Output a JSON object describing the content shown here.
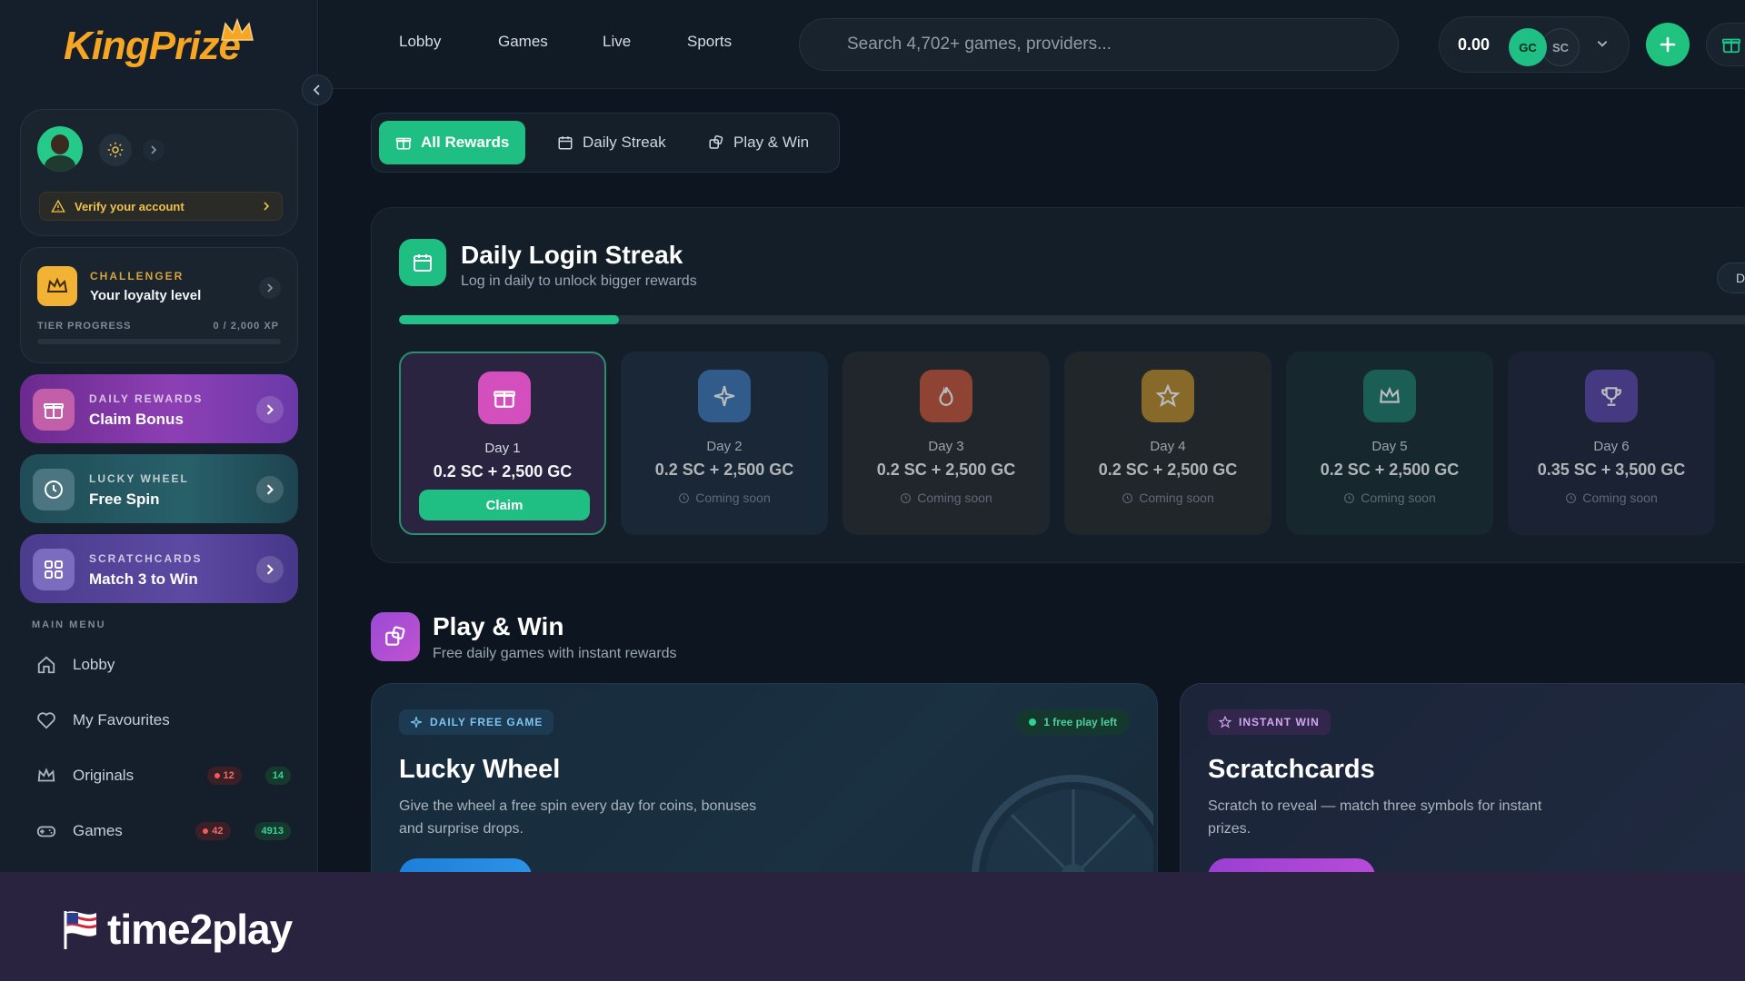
{
  "brand": {
    "logo_text": "KingPrize",
    "accent": "#f6a623",
    "primary": "#1fbf84"
  },
  "sidebar": {
    "verify_text": "Verify your account",
    "loyalty": {
      "label": "CHALLENGER",
      "title": "Your loyalty level",
      "progress_label": "TIER PROGRESS",
      "xp": "0 / 2,000 XP",
      "progress": 0
    },
    "promos": [
      {
        "label": "DAILY REWARDS",
        "title": "Claim Bonus",
        "icon": "gift-icon"
      },
      {
        "label": "LUCKY WHEEL",
        "title": "Free Spin",
        "icon": "clock-icon"
      },
      {
        "label": "SCRATCHCARDS",
        "title": "Match 3 to Win",
        "icon": "grid-icon"
      }
    ],
    "menu_heading": "MAIN MENU",
    "menu": [
      {
        "label": "Lobby",
        "icon": "home-icon"
      },
      {
        "label": "My Favourites",
        "icon": "heart-icon"
      },
      {
        "label": "Originals",
        "icon": "crown-icon",
        "live": "12",
        "count": "14"
      },
      {
        "label": "Games",
        "icon": "gamepad-icon",
        "live": "42",
        "count": "4913"
      }
    ]
  },
  "topbar": {
    "nav": [
      "Lobby",
      "Games",
      "Live",
      "Sports"
    ],
    "search_placeholder": "Search 4,702+ games, providers...",
    "balance": "0.00",
    "currency_gc": "GC",
    "currency_sc": "SC"
  },
  "tabs": [
    {
      "label": "All Rewards",
      "icon": "gift-icon",
      "active": true
    },
    {
      "label": "Daily Streak",
      "icon": "calendar-icon",
      "active": false
    },
    {
      "label": "Play & Win",
      "icon": "dice-icon",
      "active": false
    }
  ],
  "streak": {
    "title": "Daily Login Streak",
    "subtitle": "Log in daily to unlock bigger rewards",
    "chip": "Da",
    "progress": 0.16,
    "claim_label": "Claim",
    "coming_soon": "Coming soon",
    "days": [
      {
        "label": "Day 1",
        "reward": "0.2 SC + 2,500 GC",
        "icon": "gift-icon",
        "color": "#d24fbd",
        "bg": "#2a2440",
        "state": "claim"
      },
      {
        "label": "Day 2",
        "reward": "0.2 SC + 2,500 GC",
        "icon": "sparkle-icon",
        "color": "#3d76b5",
        "bg": "#1c2c3c",
        "state": "soon"
      },
      {
        "label": "Day 3",
        "reward": "0.2 SC + 2,500 GC",
        "icon": "flame-icon",
        "color": "#c45538",
        "bg": "#272a30",
        "state": "soon"
      },
      {
        "label": "Day 4",
        "reward": "0.2 SC + 2,500 GC",
        "icon": "star-icon",
        "color": "#b98a2b",
        "bg": "#272a2d",
        "state": "soon"
      },
      {
        "label": "Day 5",
        "reward": "0.2 SC + 2,500 GC",
        "icon": "crown-icon",
        "color": "#1f7a68",
        "bg": "#1a2b31",
        "state": "soon"
      },
      {
        "label": "Day 6",
        "reward": "0.35 SC + 3,500 GC",
        "icon": "trophy-icon",
        "color": "#5b47a8",
        "bg": "#1f2538",
        "state": "soon"
      }
    ]
  },
  "play_win": {
    "title": "Play & Win",
    "subtitle": "Free daily games with instant rewards",
    "cards": [
      {
        "tag": "DAILY FREE GAME",
        "badge": "1 free play left",
        "title": "Lucky Wheel",
        "desc": "Give the wheel a free spin every day for coins, bonuses and surprise drops."
      },
      {
        "tag": "INSTANT WIN",
        "title": "Scratchcards",
        "desc": "Scratch to reveal — match three symbols for instant prizes."
      }
    ]
  },
  "footer_brand": {
    "text": "time2play"
  }
}
